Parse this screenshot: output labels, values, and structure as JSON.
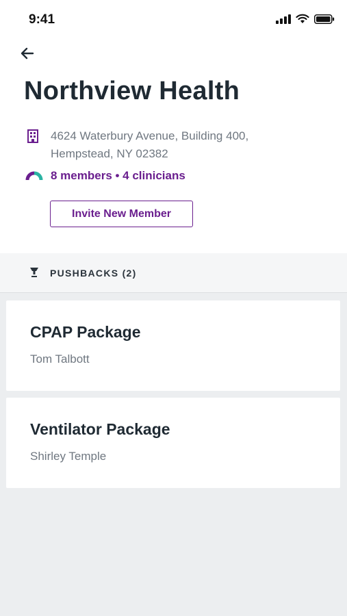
{
  "status_bar": {
    "time": "9:41",
    "icons": [
      "signal-icon",
      "wifi-icon",
      "battery-icon"
    ]
  },
  "header": {
    "back_icon": "arrow-left-icon",
    "title": "Northview Health",
    "address_line1": "4624 Waterbury Avenue, Building 400,",
    "address_line2": "Hempstead, NY 02382",
    "address_icon": "building-icon",
    "members_text": "8 members • 4 clinicians",
    "members_icon": "progress-arc-icon",
    "invite_button_label": "Invite New Member"
  },
  "section": {
    "icon": "pushback-icon",
    "label": "PUSHBACKS (2)"
  },
  "pushbacks": [
    {
      "title": "CPAP Package",
      "subtitle": "Tom Talbott"
    },
    {
      "title": "Ventilator Package",
      "subtitle": "Shirley Temple"
    }
  ],
  "colors": {
    "accent": "#6a1e8e",
    "teal": "#2bb3a3",
    "background": "#eceef0",
    "text": "#1f2a33",
    "muted": "#6f7780"
  }
}
